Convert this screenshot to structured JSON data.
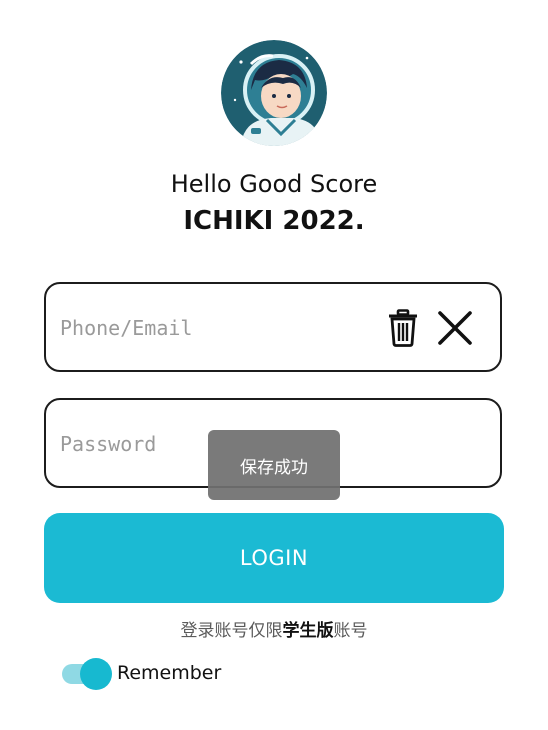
{
  "header": {
    "greeting": "Hello Good Score",
    "brand": "ICHIKI 2022."
  },
  "phone_field": {
    "placeholder": "Phone/Email",
    "value": "",
    "trash_icon": "trash-icon",
    "clear_icon": "close-icon"
  },
  "password_field": {
    "placeholder": "Password",
    "value": ""
  },
  "toast": {
    "text": "保存成功"
  },
  "login": {
    "label": "LOGIN"
  },
  "note": {
    "prefix": "登录账号仅限",
    "emphasis": "学生版",
    "suffix": "账号"
  },
  "remember": {
    "label": "Remember",
    "checked": true
  },
  "colors": {
    "accent": "#1bbad3",
    "toggle_track": "#8fd9e4",
    "toast_bg": "#707070"
  }
}
